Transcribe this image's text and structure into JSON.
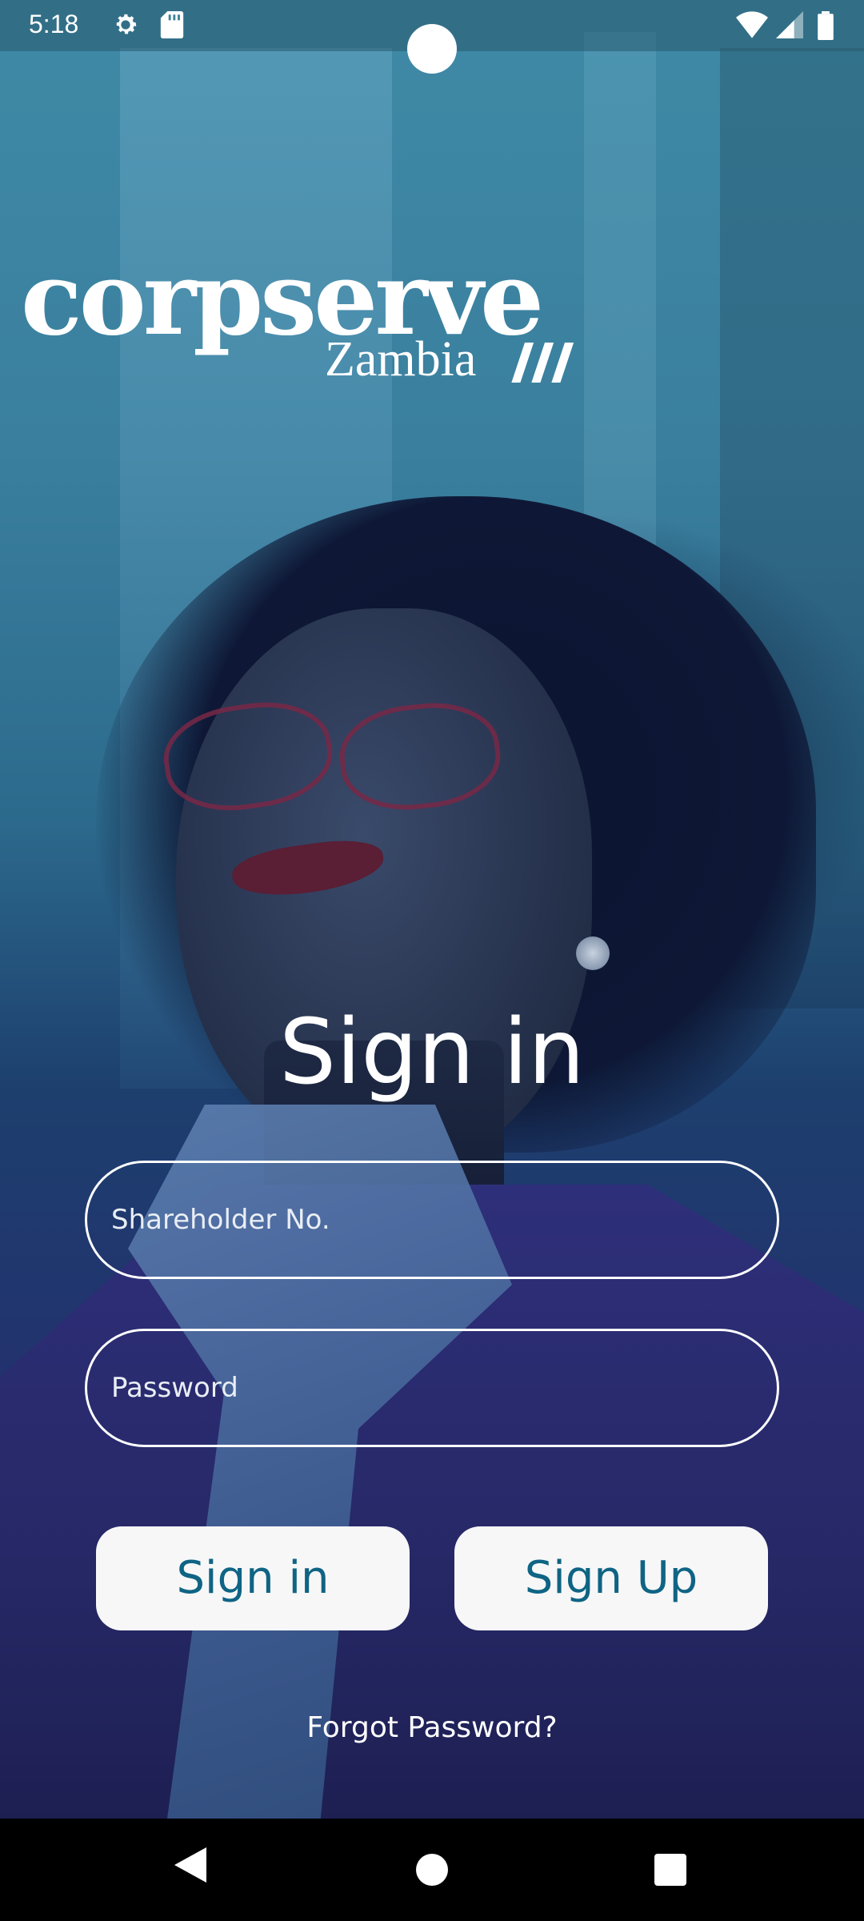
{
  "status_bar": {
    "time": "5:18",
    "icons": [
      "gear-icon",
      "sd-card-icon",
      "wifi-icon",
      "signal-icon",
      "battery-icon"
    ]
  },
  "logo": {
    "brand": "corpserve",
    "country": "Zambia"
  },
  "form": {
    "title": "Sign in",
    "shareholder_placeholder": "Shareholder No.",
    "password_placeholder": "Password",
    "sign_in_label": "Sign in",
    "sign_up_label": "Sign Up",
    "forgot_label": "Forgot Password?"
  },
  "colors": {
    "button_text": "#0f6484",
    "button_bg": "#f7f7f8",
    "field_border": "#ffffff"
  },
  "navigation": {
    "buttons": [
      "back-icon",
      "home-icon",
      "recents-icon"
    ]
  }
}
